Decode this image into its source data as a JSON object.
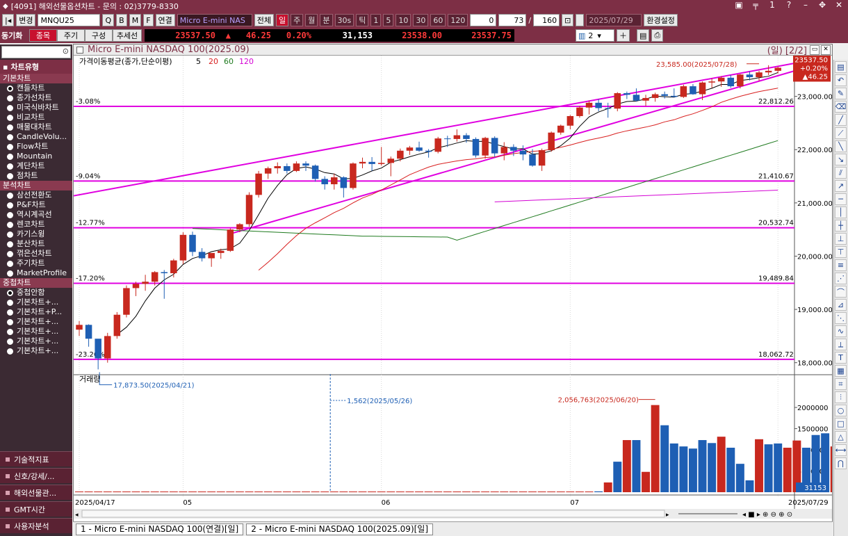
{
  "window": {
    "title": "[4091] 해외선물옵션차트 - 문의 : 02)3779-8330"
  },
  "toolbar": {
    "change_label": "변경",
    "symbol": "MNQU25",
    "link_label": "연결",
    "name_field": "Micro E-mini NAS",
    "all_label": "전체",
    "periods": [
      "일",
      "주",
      "월",
      "분",
      "30s",
      "틱"
    ],
    "intervals": [
      "1",
      "5",
      "10",
      "30",
      "60",
      "120"
    ],
    "count_a": "0",
    "count_b": "73",
    "count_c": "160",
    "date": "2025/07/29",
    "settings_label": "환경설정"
  },
  "quote": {
    "sync_label": "동기화",
    "tabs": [
      "종목",
      "주기",
      "구성",
      "추세선"
    ],
    "last": "23537.50",
    "arrow": "▲",
    "change": "46.25",
    "pct": "0.20%",
    "volume": "31,153",
    "bid": "23538.00",
    "ask": "23537.75",
    "layout_num": "2"
  },
  "sidebar": {
    "header": "차트유형",
    "cat_basic": "기본차트",
    "basic": [
      "캔들차트",
      "종가선차트",
      "미국식바차트",
      "비교차트",
      "매물대차트",
      "CandleVolu...",
      "Flow차트",
      "Mountain",
      "계단차트",
      "점차트"
    ],
    "cat_analysis": "분석차트",
    "analysis": [
      "삼선전환도",
      "P&F차트",
      "역시계곡선",
      "렌코차트",
      "카기스윙",
      "분산차트",
      "꺾은선차트",
      "주기차트",
      "MarketProfile"
    ],
    "cat_overlay": "중첩차트",
    "overlay": [
      "중첩안함",
      "기본차트+...",
      "기본차트+P...",
      "기본차트+...",
      "기본차트+...",
      "기본차트+...",
      "기본차트+..."
    ],
    "footer": [
      "기술적지표",
      "신호/강세/...",
      "해외선물관...",
      "GMT시간",
      "사용자분석"
    ]
  },
  "chart": {
    "title": "Micro E-mini NASDAQ 100(2025.09)",
    "period_tag": "(일) [2/2]",
    "ma_label": "가격이동평균(종가,단순이평)",
    "ma_periods": [
      "5",
      "20",
      "60",
      "120"
    ],
    "ma_colors": [
      "#000000",
      "#d81e1e",
      "#1e7a1e",
      "#d400d4"
    ],
    "volume_label": "거래량",
    "high_annot": "23,585.00(2025/07/28)",
    "low_annot": "17,873.50(2025/04/21)",
    "vol_max_annot": "2,056,763(2025/06/20)",
    "vol_cursor_annot": "1,562(2025/05/26)",
    "price_tag": [
      "23537.50",
      "+0.20%",
      "▲46.25"
    ],
    "vol_tag": "31153",
    "date_axis": [
      "2025/04/17",
      "05",
      "06",
      "07",
      "2025/07/29"
    ]
  },
  "chart_data": {
    "type": "candlestick",
    "levels": [
      {
        "pct": "-3.08%",
        "price": "22,812.26",
        "value": 22812.26
      },
      {
        "pct": "-9.04%",
        "price": "21,410.67",
        "value": 21410.67
      },
      {
        "pct": "-12.77%",
        "price": "20,532.74",
        "value": 20532.74
      },
      {
        "pct": "-17.20%",
        "price": "19,489.84",
        "value": 19489.84
      },
      {
        "pct": "-23.26%",
        "price": "18,062.72",
        "value": 18062.72
      }
    ],
    "price_ticks": [
      18000,
      19000,
      20000,
      21000,
      22000,
      23000
    ],
    "volume_ticks": [
      500000,
      1000000,
      1500000,
      2000000
    ],
    "candles": [
      [
        18620,
        18780,
        18500,
        18710
      ],
      [
        18710,
        18720,
        18300,
        18450
      ],
      [
        18450,
        18120,
        17873.5,
        18080
      ],
      [
        18080,
        18560,
        18000,
        18500
      ],
      [
        18500,
        18950,
        18450,
        18900
      ],
      [
        18900,
        19450,
        18850,
        19400
      ],
      [
        19400,
        19520,
        19250,
        19480
      ],
      [
        19480,
        19650,
        19350,
        19520
      ],
      [
        19520,
        19720,
        19450,
        19700
      ],
      [
        19700,
        19740,
        19200,
        19680
      ],
      [
        19680,
        19950,
        19600,
        19920
      ],
      [
        19920,
        20450,
        19850,
        20400
      ],
      [
        20400,
        20460,
        20000,
        20080
      ],
      [
        20080,
        20150,
        19900,
        19960
      ],
      [
        19960,
        20050,
        19800,
        20060
      ],
      [
        20060,
        20140,
        19950,
        20100
      ],
      [
        20100,
        20520,
        20080,
        20500
      ],
      [
        20500,
        20620,
        20450,
        20600
      ],
      [
        20600,
        21200,
        20550,
        21150
      ],
      [
        21150,
        21600,
        21100,
        21550
      ],
      [
        21550,
        21680,
        21450,
        21650
      ],
      [
        21650,
        21760,
        21550,
        21690
      ],
      [
        21690,
        21740,
        21550,
        21600
      ],
      [
        21600,
        21780,
        21580,
        21740
      ],
      [
        21740,
        21780,
        21600,
        21700
      ],
      [
        21700,
        21720,
        21400,
        21450
      ],
      [
        21450,
        21500,
        21250,
        21350
      ],
      [
        21350,
        21550,
        21250,
        21480
      ],
      [
        21480,
        21500,
        21100,
        21280
      ],
      [
        21280,
        21760,
        21250,
        21740
      ],
      [
        21740,
        21850,
        21650,
        21770
      ],
      [
        21770,
        21860,
        21600,
        21730
      ],
      [
        21730,
        22050,
        21700,
        21750
      ],
      [
        21750,
        21870,
        21500,
        21830
      ],
      [
        21830,
        22020,
        21780,
        21980
      ],
      [
        21980,
        22070,
        21900,
        22040
      ],
      [
        22040,
        22150,
        21960,
        21980
      ],
      [
        21980,
        22010,
        21850,
        21960
      ],
      [
        21960,
        22240,
        21930,
        22210
      ],
      [
        22210,
        22260,
        22050,
        22200
      ],
      [
        22200,
        22380,
        22150,
        22270
      ],
      [
        22270,
        22310,
        22130,
        22200
      ],
      [
        22200,
        22230,
        21850,
        21890
      ],
      [
        21890,
        22240,
        21830,
        22220
      ],
      [
        22220,
        22250,
        21860,
        21930
      ],
      [
        21930,
        22140,
        21800,
        22050
      ],
      [
        22050,
        22100,
        21880,
        21980
      ],
      [
        21980,
        22080,
        21800,
        21910
      ],
      [
        21910,
        22010,
        21680,
        21700
      ],
      [
        21700,
        22020,
        21600,
        21990
      ],
      [
        21990,
        22340,
        21960,
        22320
      ],
      [
        22320,
        22470,
        22280,
        22450
      ],
      [
        22450,
        22650,
        22380,
        22630
      ],
      [
        22630,
        22820,
        22600,
        22790
      ],
      [
        22790,
        22920,
        22660,
        22880
      ],
      [
        22880,
        22950,
        22720,
        22780
      ],
      [
        22780,
        22880,
        22600,
        22770
      ],
      [
        22770,
        23080,
        22720,
        23060
      ],
      [
        23060,
        23090,
        22950,
        23030
      ],
      [
        23030,
        23150,
        22900,
        22920
      ],
      [
        22920,
        23030,
        22820,
        22970
      ],
      [
        22970,
        23070,
        22900,
        23040
      ],
      [
        23040,
        23090,
        22960,
        23010
      ],
      [
        23010,
        23150,
        22980,
        22990
      ],
      [
        22990,
        23220,
        22970,
        23190
      ],
      [
        23190,
        23230,
        23030,
        23040
      ],
      [
        23040,
        23280,
        22930,
        23260
      ],
      [
        23260,
        23340,
        23160,
        23280
      ],
      [
        23280,
        23380,
        23180,
        23350
      ],
      [
        23350,
        23400,
        23160,
        23190
      ],
      [
        23190,
        23420,
        23150,
        23410
      ],
      [
        23410,
        23470,
        23300,
        23360
      ],
      [
        23360,
        23480,
        23290,
        23450
      ],
      [
        23450,
        23585,
        23400,
        23480
      ],
      [
        23480,
        23560,
        23430,
        23537.5
      ]
    ],
    "volumes": [
      0,
      0,
      0,
      0,
      0,
      0,
      0,
      0,
      0,
      0,
      0,
      0,
      0,
      0,
      0,
      0,
      0,
      0,
      0,
      0,
      0,
      0,
      0,
      0,
      0,
      0,
      1562,
      0,
      0,
      0,
      0,
      0,
      0,
      0,
      0,
      0,
      0,
      0,
      0,
      0,
      0,
      0,
      0,
      0,
      0,
      0,
      0,
      0,
      0,
      0,
      0,
      0,
      0,
      0,
      0,
      0,
      0,
      0,
      0,
      0,
      0,
      0,
      0,
      0,
      0,
      0,
      0,
      0,
      0,
      0,
      0,
      0,
      0,
      0,
      0
    ],
    "volume_bars": [
      {
        "i": 55,
        "v": 20000,
        "up": true
      },
      {
        "i": 56,
        "v": 230000,
        "up": false
      },
      {
        "i": 57,
        "v": 720000,
        "up": true
      },
      {
        "i": 58,
        "v": 1230000,
        "up": false
      },
      {
        "i": 59,
        "v": 1230000,
        "up": true
      },
      {
        "i": 60,
        "v": 480000,
        "up": false
      },
      {
        "i": 61,
        "v": 2056763,
        "up": false
      },
      {
        "i": 62,
        "v": 1580000,
        "up": true
      },
      {
        "i": 63,
        "v": 1150000,
        "up": true
      },
      {
        "i": 64,
        "v": 1080000,
        "up": true
      },
      {
        "i": 65,
        "v": 1030000,
        "up": true
      },
      {
        "i": 66,
        "v": 1230000,
        "up": true
      },
      {
        "i": 67,
        "v": 1160000,
        "up": true
      },
      {
        "i": 68,
        "v": 1310000,
        "up": false
      },
      {
        "i": 69,
        "v": 1050000,
        "up": true
      },
      {
        "i": 70,
        "v": 670000,
        "up": true
      },
      {
        "i": 71,
        "v": 280000,
        "up": true
      },
      {
        "i": 72,
        "v": 1250000,
        "up": false
      },
      {
        "i": 73,
        "v": 1130000,
        "up": true
      },
      {
        "i": 74,
        "v": 1150000,
        "up": true
      },
      {
        "i": 75,
        "v": 1050000,
        "up": false
      },
      {
        "i": 76,
        "v": 1220000,
        "up": false
      },
      {
        "i": 77,
        "v": 1050000,
        "up": true
      },
      {
        "i": 78,
        "v": 1350000,
        "up": true
      },
      {
        "i": 79,
        "v": 1390000,
        "up": true
      },
      {
        "i": 80,
        "v": 1080000,
        "up": false
      },
      {
        "i": 81,
        "v": 1070000,
        "up": false
      },
      {
        "i": 82,
        "v": 980000,
        "up": true
      },
      {
        "i": 83,
        "v": 1230000,
        "up": false
      },
      {
        "i": 84,
        "v": 1230000,
        "up": false
      },
      {
        "i": 85,
        "v": 1060000,
        "up": true
      },
      {
        "i": 86,
        "v": 920000,
        "up": true
      },
      {
        "i": 87,
        "v": 950000,
        "up": false
      },
      {
        "i": 88,
        "v": 31153,
        "up": true
      }
    ]
  },
  "tabs": [
    "1 - Micro E-mini NASDAQ 100(연결)[일]",
    "2 - Micro E-mini NASDAQ 100(2025.09)[일]"
  ]
}
